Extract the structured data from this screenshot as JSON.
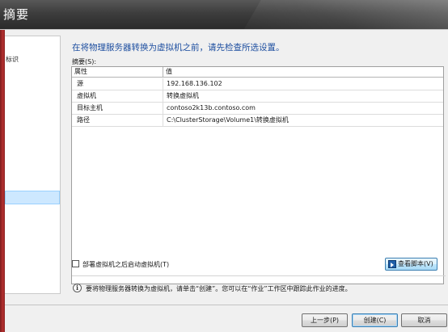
{
  "window": {
    "title": "摘要"
  },
  "steps": {
    "identify_label": "标识"
  },
  "main": {
    "heading": "在将物理服务器转换为虚拟机之前，请先检查所选设置。",
    "summary_label": "摘要(S):",
    "columns": {
      "property": "属性",
      "value": "值"
    },
    "rows": [
      {
        "property": "源",
        "value": "192.168.136.102"
      },
      {
        "property": "虚拟机",
        "value": "转换虚拟机"
      },
      {
        "property": "目标主机",
        "value": "contoso2k13b.contoso.com"
      },
      {
        "property": "路径",
        "value": "C:\\ClusterStorage\\Volume1\\转换虚拟机"
      }
    ],
    "start_vm_checkbox": {
      "label": "部署虚拟机之后启动虚拟机(T)",
      "checked": false
    },
    "view_script_label": "查看脚本(V)",
    "view_script_icon": "script-icon",
    "info_icon": "info-icon",
    "info_text": "要将物理服务器转换为虚拟机，请单击“创建”。您可以在“作业”工作区中跟踪此作业的进度。"
  },
  "footer": {
    "prev_label": "上一步(P)",
    "create_label": "创建(C)",
    "cancel_label": "取消"
  },
  "colors": {
    "heading": "#1e4fa0",
    "title_bar": "#3d3d3d",
    "selected_step": "#cde8ff",
    "left_border": "#b53030"
  }
}
